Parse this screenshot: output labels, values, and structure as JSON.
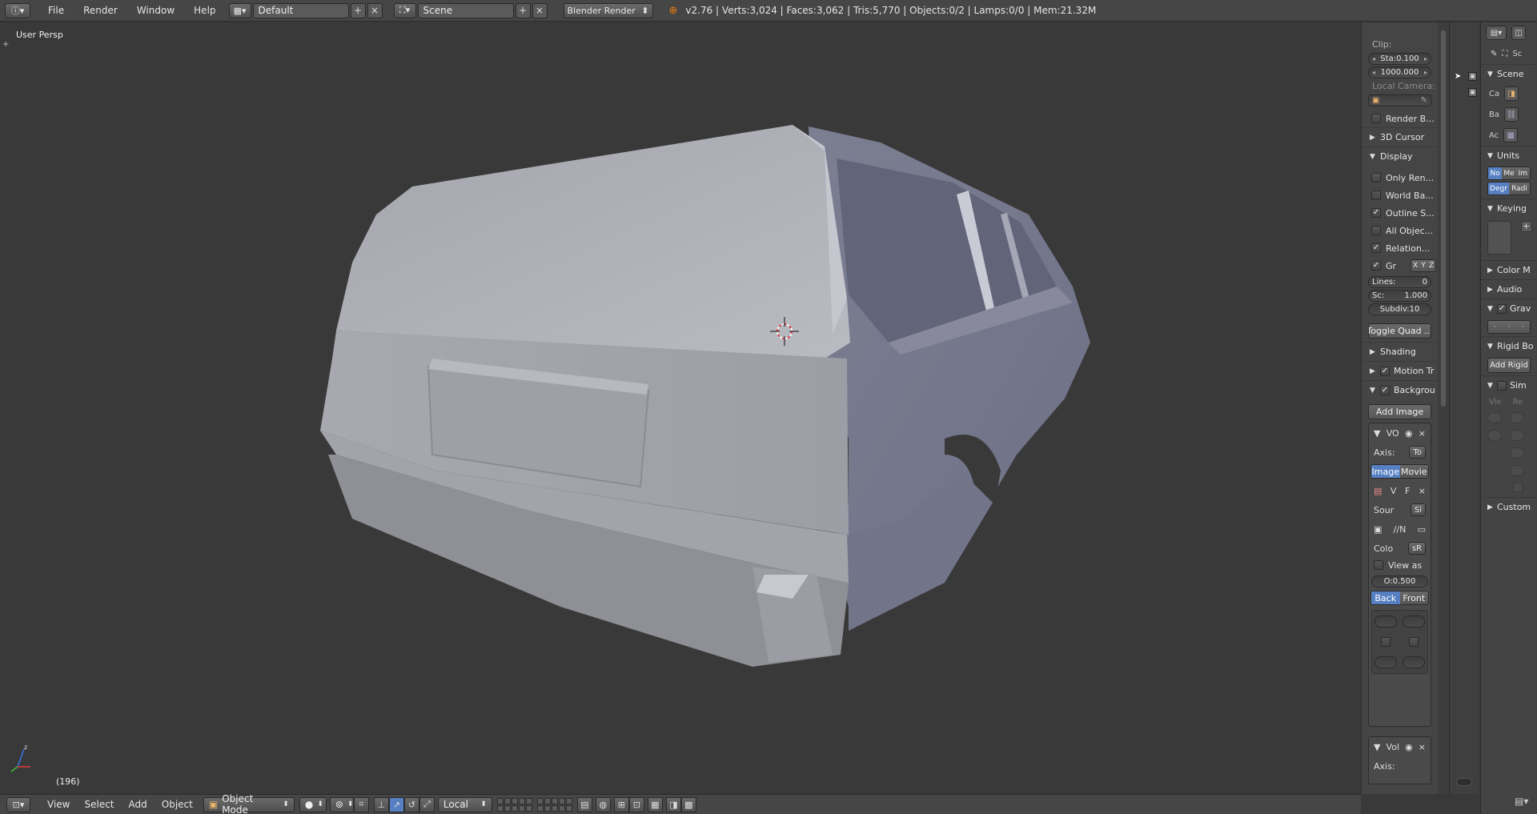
{
  "topbar": {
    "menus": [
      "File",
      "Render",
      "Window",
      "Help"
    ],
    "screen_layout": "Default",
    "scene": "Scene",
    "render_engine": "Blender Render",
    "stats": "v2.76 | Verts:3,024 | Faces:3,062 | Tris:5,770 | Objects:0/2 | Lamps:0/0 | Mem:21.32M"
  },
  "viewport": {
    "view_name": "User Persp",
    "frame": "(196)",
    "model_color": "#a9aab4",
    "background_color": "#393939"
  },
  "npanel": {
    "clip_label": "Clip:",
    "clip_start": "Sta:0.100",
    "clip_end": "1000.000",
    "local_camera_label": "Local Camera:",
    "render_border": "Render B...",
    "cursor_section": "3D Cursor",
    "display_section": "Display",
    "display_options": [
      {
        "label": "Only Ren...",
        "checked": false
      },
      {
        "label": "World Ba...",
        "checked": false
      },
      {
        "label": "Outline S...",
        "checked": true
      },
      {
        "label": "All Objec...",
        "checked": false
      },
      {
        "label": "Relation...",
        "checked": true
      }
    ],
    "grid_label": "Gr",
    "grid_axes": [
      "X",
      "Y",
      "Z"
    ],
    "lines": "Lines:",
    "lines_value": "0",
    "scale": "Sc:",
    "scale_value": "1.000",
    "subdiv": "Subdiv:10",
    "toggle_quad": "Toggle Quad ...",
    "shading_section": "Shading",
    "motion_section": "Motion Tr",
    "background_section": "Backgrou",
    "add_image": "Add Image",
    "bg_item1": "VO",
    "axis_label": "Axis:",
    "axis_value": "To",
    "image_tab": "Image",
    "movie_tab": "Movie",
    "v_label": "V",
    "f_label": "F",
    "source_label": "Sour",
    "source_value": "Si",
    "path_text": "//N",
    "color_label": "Colo",
    "color_value": "sR",
    "view_as": "View as",
    "opacity": "O:0.500",
    "back_tab": "Back",
    "front_tab": "Front",
    "bg_item2": "Vol",
    "axis2": "Axis:"
  },
  "props": {
    "sc": "Sc",
    "scene_section": "Scene",
    "camera_label": "Ca",
    "background_label": "Ba",
    "active_label": "Ac",
    "units_section": "Units",
    "units_tabs": [
      "No",
      "Me",
      "Im"
    ],
    "rot_tabs": [
      "Degr",
      "Radi"
    ],
    "keying_section": "Keying",
    "color_section": "Color M",
    "audio_section": "Audio",
    "gravity_section": "Grav",
    "rigid_section": "Rigid Bo",
    "add_rigid": "Add Rigid",
    "sim_section": "Sim",
    "vie_label": "Vie",
    "re_label": "Re",
    "custom_section": "Custom"
  },
  "bottombar": {
    "menus": [
      "View",
      "Select",
      "Add",
      "Object"
    ],
    "mode": "Object Mode",
    "pivot_orientation": "Local"
  }
}
